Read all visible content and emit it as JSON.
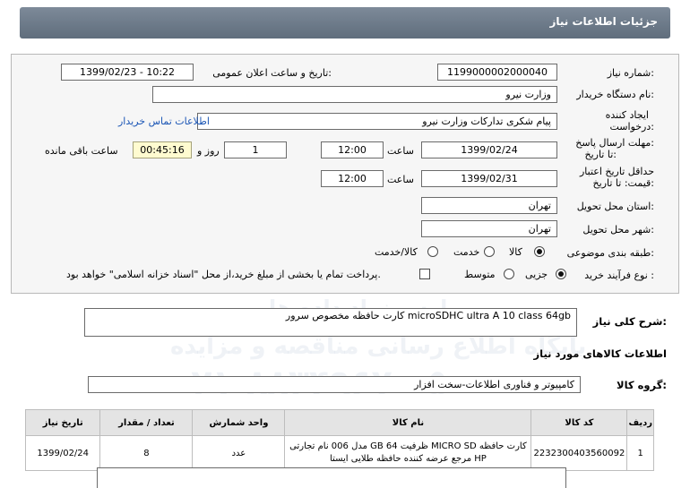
{
  "header": {
    "title": "جزئیات اطلاعات نیاز"
  },
  "form": {
    "need_no_label": "شماره نیاز:",
    "need_no": "1199000002000040",
    "announce_label": "تاریخ و ساعت اعلان عمومی:",
    "announce_value": "1399/02/23 - 10:22",
    "buyer_label": "نام دستگاه خریدار:",
    "buyer_value": "وزارت نیرو",
    "creator_label_1": "ایجاد کننده",
    "creator_label_2": "درخواست:",
    "creator_value": "پیام شکری تدارکات وزارت نیرو",
    "contact_link": "اطلاعات تماس خریدار",
    "deadline_label_1": "مهلت ارسال پاسخ:",
    "deadline_label_2": "تا تاریخ:",
    "deadline_date": "1399/02/24",
    "time_label": "ساعت",
    "deadline_time": "12:00",
    "days_value": "1",
    "days_label": "روز و",
    "remaining_value": "00:45:16",
    "remaining_label": "ساعت باقی مانده",
    "validity_label_1": "حداقل تاریخ اعتبار",
    "validity_label_2": "قیمت: تا تاریخ:",
    "validity_date": "1399/02/31",
    "validity_time_label": "ساعت",
    "validity_time": "12:00",
    "province_label": "استان محل تحویل:",
    "province_value": "تهران",
    "city_label": "شهر محل تحویل:",
    "city_value": "تهران",
    "category_label": "طبقه بندی موضوعی:",
    "category_options": [
      "کالا",
      "خدمت",
      "کالا/خدمت"
    ],
    "process_label": "نوع فرآیند خرید :",
    "process_options": [
      "جزیی",
      "متوسط"
    ],
    "payment_note": "پرداخت تمام یا بخشی از مبلغ خرید،از محل \"اسناد خزانه اسلامی\" خواهد بود."
  },
  "description": {
    "label": "شرح کلی نیاز:",
    "value": "کارت حافظه مخصوص سرور microSDHC ultra A 10 class 64gb"
  },
  "goods_info_title": "اطلاعات کالاهای مورد نیاز",
  "goods_group": {
    "label": "گروه کالا:",
    "value": "کامپیوتر و فناوری اطلاعات-سخت افزار"
  },
  "table": {
    "headers": [
      "ردیف",
      "کد کالا",
      "نام کالا",
      "واحد شمارش",
      "تعداد / مقدار",
      "تاریخ نیاز"
    ],
    "rows": [
      {
        "index": "1",
        "code": "2232300403560092",
        "name_1": "کارت حافظه MICRO SD ظرفیت 64 GB مدل 006 نام تجارتی",
        "name_2": "HP مرجع عرضه کننده حافظه طلایی ایستا",
        "unit": "عدد",
        "qty": "8",
        "date": "1399/02/24"
      }
    ]
  },
  "watermark": {
    "line1": "پایگاه اطلاع رسانی مناقصه و مزایده",
    "line2": "۰۲۱-۸۸۳۴۹۶۷۰-۵",
    "line3": "ParsNamadData",
    "line4": "پارس نماد داده ها"
  }
}
